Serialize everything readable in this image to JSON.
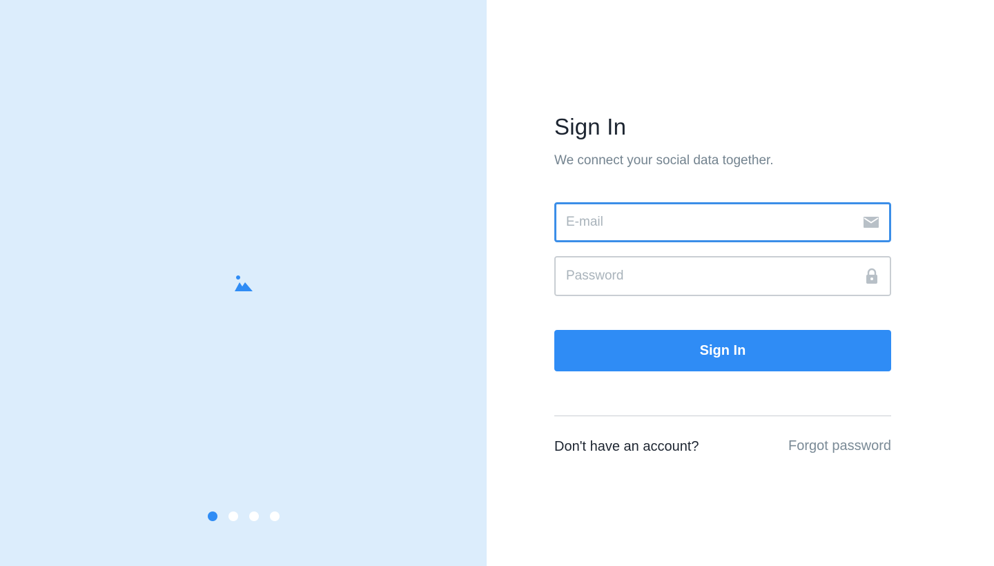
{
  "hero": {
    "icon": "image-placeholder-icon",
    "background_color": "#dcedfc"
  },
  "carousel": {
    "dot_count": 4,
    "active_index": 0,
    "active_color": "#2f8cf5"
  },
  "form": {
    "title": "Sign In",
    "subtitle": "We connect your social data together.",
    "email": {
      "placeholder": "E-mail",
      "value": "",
      "icon": "mail-icon"
    },
    "password": {
      "placeholder": "Password",
      "value": "",
      "icon": "lock-icon"
    },
    "submit_label": "Sign In",
    "submit_color": "#2f8cf5",
    "no_account_text": "Don't have an account?",
    "forgot_password_text": "Forgot password"
  }
}
